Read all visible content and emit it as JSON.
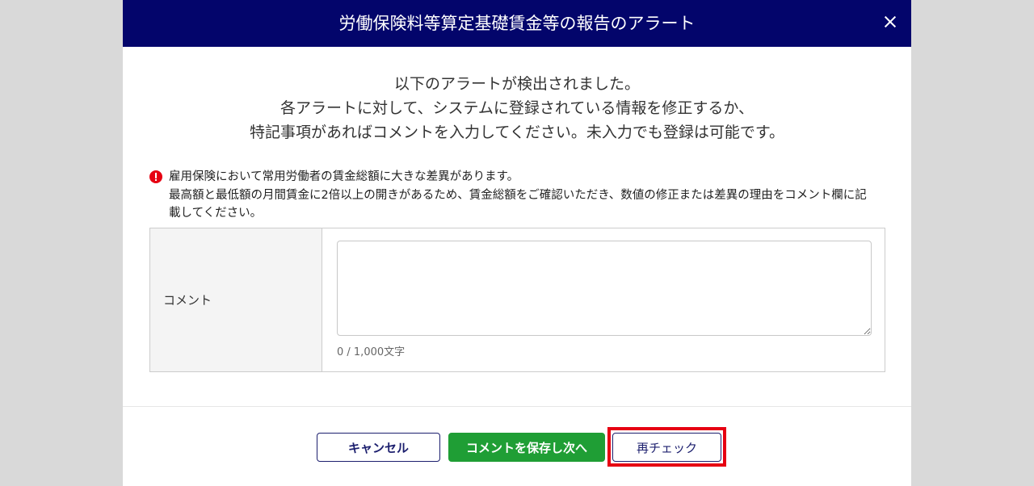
{
  "colors": {
    "page_bg": "#d9d9d9",
    "header_bg": "#03056b",
    "accent": "#1c1f6e",
    "primary_button": "#1f9e35",
    "alert_icon": "#e60012",
    "highlight_frame": "#e60012"
  },
  "modal": {
    "title": "労働保険料等算定基礎賃金等の報告のアラート",
    "close_icon": "close-icon",
    "intro_lines": [
      "以下のアラートが検出されました。",
      "各アラートに対して、システムに登録されている情報を修正するか、",
      "特記事項があればコメントを入力してください。未入力でも登録は可能です。"
    ],
    "alert": {
      "icon": "exclamation-circle-icon",
      "title": "雇用保険において常用労働者の賃金総額に大きな差異があります。",
      "detail": "最高額と最低額の月間賃金に2倍以上の開きがあるため、賃金総額をご確認いただき、数値の修正または差異の理由をコメント欄に記載してください。"
    },
    "comment": {
      "label": "コメント",
      "value": "",
      "counter": "0 / 1,000文字"
    },
    "buttons": {
      "cancel": "キャンセル",
      "save_next": "コメントを保存し次へ",
      "recheck": "再チェック"
    }
  }
}
